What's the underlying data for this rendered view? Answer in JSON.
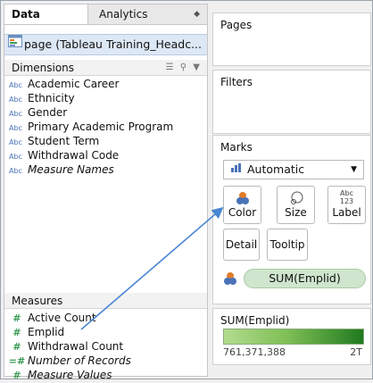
{
  "tabs": {
    "data": "Data",
    "analytics": "Analytics"
  },
  "datasource": {
    "name": "page (Tableau Training_Headc..."
  },
  "dimensions": {
    "header": "Dimensions",
    "fields": [
      {
        "icon": "Abc",
        "label": "Academic Career"
      },
      {
        "icon": "Abc",
        "label": "Ethnicity"
      },
      {
        "icon": "Abc",
        "label": "Gender"
      },
      {
        "icon": "Abc",
        "label": "Primary Academic Program"
      },
      {
        "icon": "Abc",
        "label": "Student Term"
      },
      {
        "icon": "Abc",
        "label": "Withdrawal Code"
      },
      {
        "icon": "Abc",
        "label": "Measure Names"
      }
    ]
  },
  "measures": {
    "header": "Measures",
    "fields": [
      {
        "icon": "#",
        "label": "Active Count"
      },
      {
        "icon": "#",
        "label": "Emplid"
      },
      {
        "icon": "#",
        "label": "Withdrawal Count"
      },
      {
        "icon": "=#",
        "label": "Number of Records"
      },
      {
        "icon": "#",
        "label": "Measure Values"
      }
    ]
  },
  "shelves": {
    "pages": "Pages",
    "filters": "Filters",
    "marks": "Marks"
  },
  "marks": {
    "type": "Automatic",
    "buttons": {
      "color": "Color",
      "size": "Size",
      "label": "Label",
      "label_icon_top": "Abc",
      "label_icon_bottom": "123",
      "detail": "Detail",
      "tooltip": "Tooltip"
    },
    "pill": "SUM(Emplid)"
  },
  "legend": {
    "title": "SUM(Emplid)",
    "min": "761,371,388",
    "max": "2T"
  },
  "colors": {
    "pill": "#cfe5cd",
    "legend_low": "#b2dc8e",
    "legend_high": "#1f7a1f",
    "arrow": "#4a86d4",
    "datasource_bg": "#dde8f5"
  }
}
